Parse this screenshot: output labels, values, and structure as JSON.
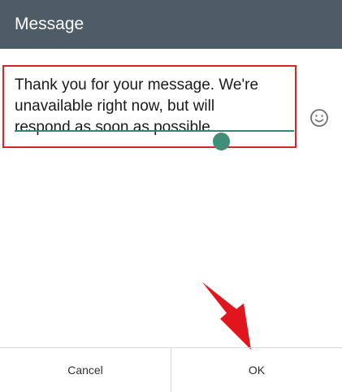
{
  "dialog": {
    "title": "Message",
    "message_lines": [
      "Thank you for your message. We're",
      "unavailable right now, but will",
      "respond as soon as possible."
    ],
    "buttons": {
      "cancel": "Cancel",
      "ok": "OK"
    }
  },
  "icons": {
    "emoji": "emoji-icon",
    "annotation_arrow": "pointer-arrow-icon"
  },
  "colors": {
    "title_bar": "#4e5c66",
    "highlight": "#d7262b",
    "accent": "#2d8a70",
    "arrow": "#e1151d"
  }
}
